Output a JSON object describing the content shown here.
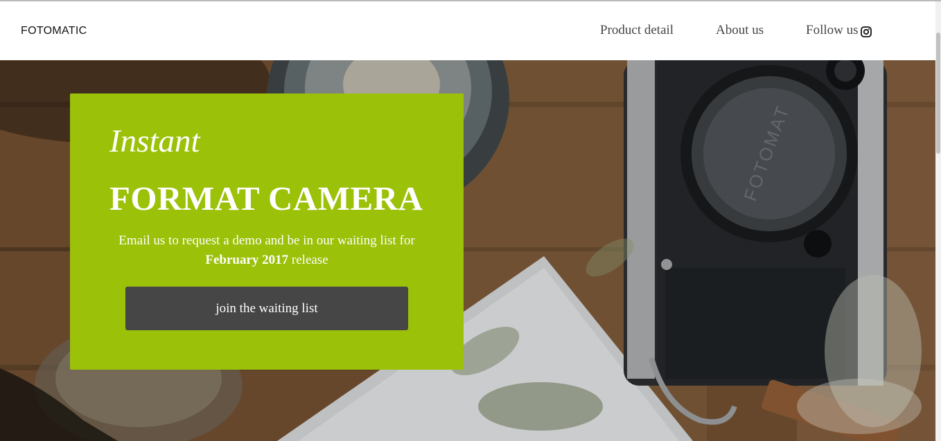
{
  "navbar": {
    "brand": "FOTOMATIC",
    "links": [
      {
        "label": "Product detail"
      },
      {
        "label": "About us"
      },
      {
        "label": "Follow us",
        "icon": "instagram-icon"
      }
    ]
  },
  "hero": {
    "tagline": "Instant",
    "headline": "FORMAT CAMERA",
    "description_start": "Email us to request a demo and be in our waiting list for ",
    "description_bold": "February 2017",
    "description_end": " release",
    "cta_label": "join the waiting list",
    "camera_brand_text": "FOTOMAT",
    "card_color": "#9bc108",
    "button_color": "#464646"
  }
}
